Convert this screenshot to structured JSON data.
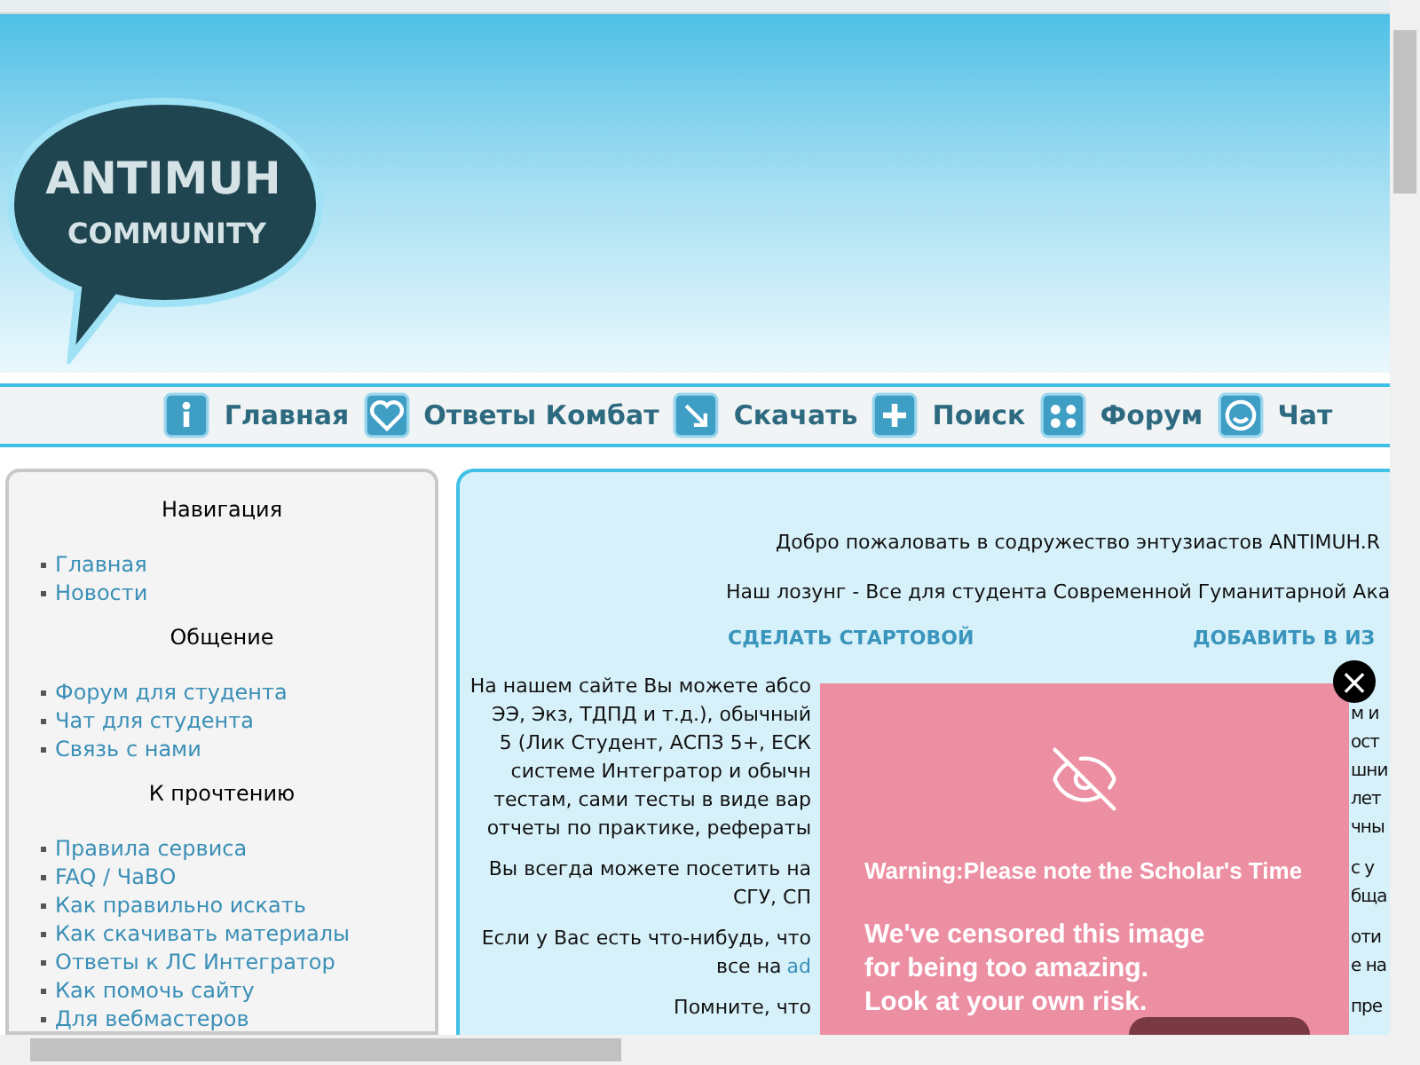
{
  "logo": {
    "line_1": "ANTIMUH",
    "line_2": "COMMUNITY"
  },
  "nav": [
    {
      "label": "Главная",
      "kind": "info"
    },
    {
      "label": "Ответы Комбат",
      "kind": "heart"
    },
    {
      "label": "Скачать",
      "kind": "download"
    },
    {
      "label": "Поиск",
      "kind": "plus"
    },
    {
      "label": "Форум",
      "kind": "dots"
    },
    {
      "label": "Чат",
      "kind": "smile"
    }
  ],
  "sidebar": {
    "sections": [
      {
        "title": "Навигация",
        "links": [
          "Главная",
          "Новости"
        ]
      },
      {
        "title": "Общение",
        "links": [
          "Форум для студента",
          "Чат для студента",
          "Связь с нами"
        ]
      },
      {
        "title": "К прочтению",
        "links": [
          "Правила сервиса",
          "FAQ / ЧаВО",
          "Как правильно искать",
          "Как скачивать материалы",
          "Ответы к ЛС Интегратор",
          "Как помочь сайту",
          "Для вебмастеров"
        ]
      }
    ]
  },
  "content": {
    "welcome": "Добро пожаловать в содружество энтузиастов ANTIMUH.R",
    "slogan": "Наш лозунг - Все для студента Современной Гуманитарной Ака",
    "actions": [
      "СДЕЛАТЬ СТАРТОВОЙ",
      "ДОБАВИТЬ В ИЗ"
    ],
    "paragraphs": [
      [
        {
          "left": "На нашем сайте Вы можете абсо"
        },
        {
          "left": "ЭЭ, Экз, ТДПД и т.д.), обычный",
          "right": "м и"
        },
        {
          "left": "5 (Лик Студент, АСПЗ 5+, ЕСК",
          "right": "ост"
        },
        {
          "left": "системе Интегратор и обычн",
          "right": "шни"
        },
        {
          "left": "тестам, сами тесты в виде вар",
          "right": "лет"
        },
        {
          "left": "отчеты по практике, рефераты",
          "right": "чны"
        }
      ],
      [
        {
          "left": "Вы всегда можете посетить на",
          "right": "с у"
        },
        {
          "left": "СГУ, СП",
          "right": "бща"
        }
      ],
      [
        {
          "left": "Если у Вас есть что-нибудь, что",
          "right": "оти"
        },
        {
          "left": "все на",
          "link": "ad",
          "right": "е на"
        }
      ],
      [
        {
          "left": "Помните, что",
          "right": "пре"
        }
      ]
    ]
  },
  "ad": {
    "close": "×",
    "warning": "Warning:Please note the Scholar's Time",
    "message": [
      "We've censored this image",
      "for being too amazing.",
      "Look at your own risk."
    ]
  }
}
